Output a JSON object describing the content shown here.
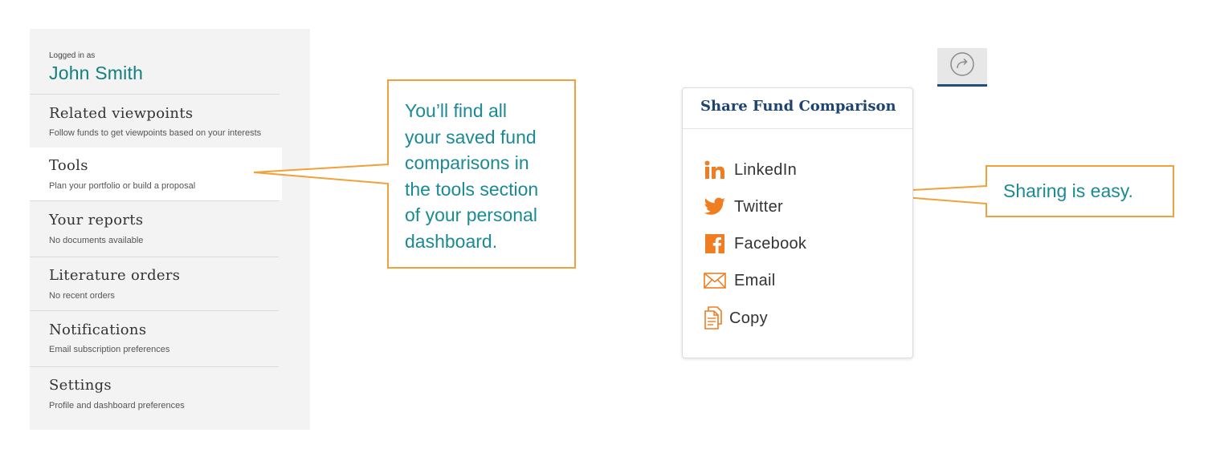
{
  "sidebar": {
    "login_label": "Logged in as",
    "user_name": "John Smith",
    "items": [
      {
        "title": "Related viewpoints",
        "subtitle": "Follow funds to get viewpoints based  on your interests"
      },
      {
        "title": "Tools",
        "subtitle": "Plan your portfolio or build a  proposal"
      },
      {
        "title": "Your reports",
        "subtitle": "No documents available"
      },
      {
        "title": "Literature orders",
        "subtitle": "No recent orders"
      },
      {
        "title": "Notifications",
        "subtitle": "Email subscription preferences"
      },
      {
        "title": "Settings",
        "subtitle": "Profile and dashboard preferences"
      }
    ]
  },
  "callouts": {
    "tools_note_lines": [
      "You’ll find all",
      "your saved fund",
      "comparisons in",
      "the tools section",
      "of your personal",
      "dashboard."
    ],
    "share_note": "Sharing is easy."
  },
  "share": {
    "title": "Share Fund Comparison",
    "items": [
      {
        "label": "LinkedIn",
        "icon": "linkedin-icon"
      },
      {
        "label": "Twitter",
        "icon": "twitter-icon"
      },
      {
        "label": "Facebook",
        "icon": "facebook-icon"
      },
      {
        "label": "Email",
        "icon": "email-icon"
      },
      {
        "label": "Copy",
        "icon": "copy-icon"
      }
    ]
  },
  "colors": {
    "accent_teal": "#12807f",
    "callout_orange": "#f0a13a",
    "icon_orange": "#ef7d22",
    "share_title_navy": "#1b4472"
  }
}
